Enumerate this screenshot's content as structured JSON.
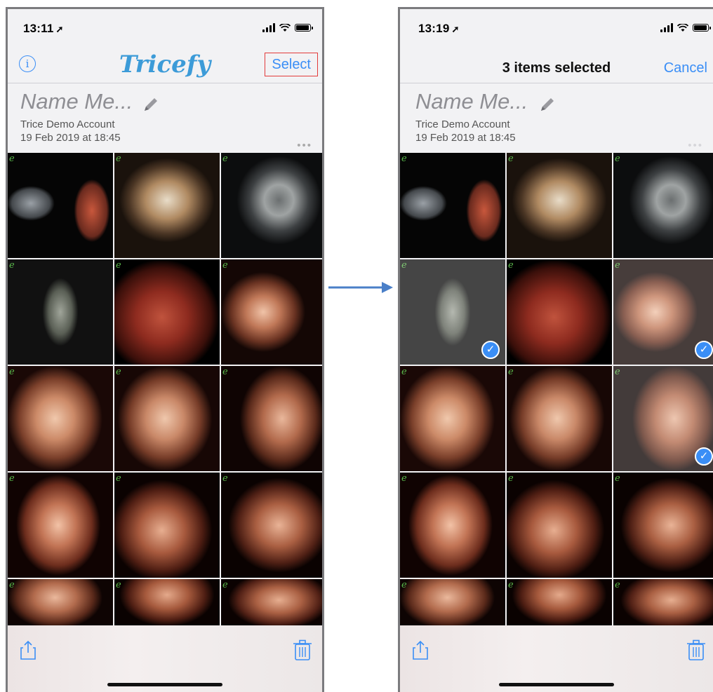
{
  "left_screen": {
    "time": "13:11",
    "nav": {
      "info_label": "i",
      "brand": "Tricefy",
      "select_label": "Select"
    },
    "study": {
      "name": "Name Me...",
      "account": "Trice Demo Account",
      "date": "19 Feb 2019 at 18:45",
      "more": "•••"
    },
    "mark": "e"
  },
  "right_screen": {
    "time": "13:19",
    "nav": {
      "title": "3 items selected",
      "cancel_label": "Cancel"
    },
    "study": {
      "name": "Name Me...",
      "account": "Trice Demo Account",
      "date": "19 Feb 2019 at 18:45",
      "more": "•••"
    },
    "selected_tiles": [
      3,
      5,
      8
    ],
    "check_glyph": "✓"
  },
  "icons": [
    "location-arrow-icon",
    "signal-icon",
    "wifi-icon",
    "battery-icon",
    "pencil-icon",
    "share-icon",
    "trash-icon",
    "checkmark-icon"
  ],
  "colors": {
    "accent": "#3a8ef6",
    "brand": "#3c9bd8",
    "highlight": "#e23b3b",
    "arrow": "#4a7fc8"
  }
}
